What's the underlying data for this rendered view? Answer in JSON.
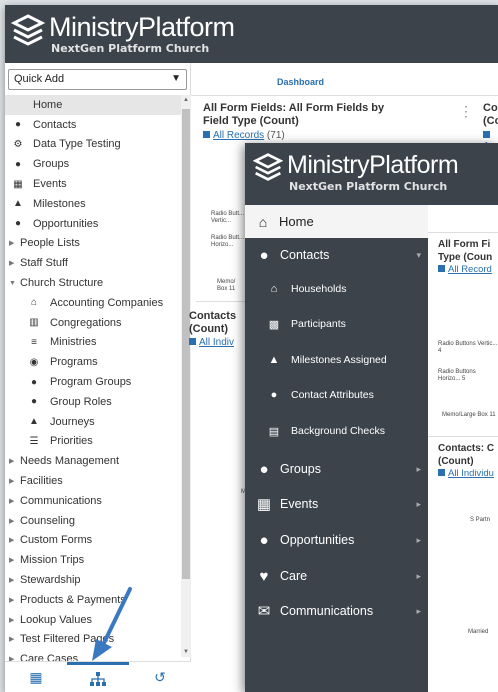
{
  "back": {
    "brand": "MinistryPlatform",
    "subtitle": "NextGen Platform Church",
    "quick_add": "Quick Add",
    "dashboard_tab": "Dashboard",
    "nav": [
      {
        "label": "Home",
        "type": "home"
      },
      {
        "label": "Contacts",
        "type": "top",
        "icon": "person-icon"
      },
      {
        "label": "Data Type Testing",
        "type": "top",
        "icon": "gear-icon"
      },
      {
        "label": "Groups",
        "type": "top",
        "icon": "people-icon"
      },
      {
        "label": "Events",
        "type": "top",
        "icon": "calendar-icon"
      },
      {
        "label": "Milestones",
        "type": "top",
        "icon": "graduation-cap-icon"
      },
      {
        "label": "Opportunities",
        "type": "top",
        "icon": "lightbulb-icon"
      },
      {
        "label": "People Lists",
        "type": "group"
      },
      {
        "label": "Staff Stuff",
        "type": "group"
      },
      {
        "label": "Church Structure",
        "type": "group-open"
      },
      {
        "label": "Accounting Companies",
        "type": "sub",
        "icon": "bank-icon"
      },
      {
        "label": "Congregations",
        "type": "sub",
        "icon": "building-icon"
      },
      {
        "label": "Ministries",
        "type": "sub",
        "icon": "signpost-icon"
      },
      {
        "label": "Programs",
        "type": "sub",
        "icon": "compass-icon"
      },
      {
        "label": "Program Groups",
        "type": "sub",
        "icon": "people-icon"
      },
      {
        "label": "Group Roles",
        "type": "sub",
        "icon": "people-icon"
      },
      {
        "label": "Journeys",
        "type": "sub",
        "icon": "graduation-cap-icon"
      },
      {
        "label": "Priorities",
        "type": "sub",
        "icon": "list-icon"
      },
      {
        "label": "Needs Management",
        "type": "group"
      },
      {
        "label": "Facilities",
        "type": "group"
      },
      {
        "label": "Communications",
        "type": "group"
      },
      {
        "label": "Counseling",
        "type": "group"
      },
      {
        "label": "Custom Forms",
        "type": "group"
      },
      {
        "label": "Mission Trips",
        "type": "group"
      },
      {
        "label": "Stewardship",
        "type": "group"
      },
      {
        "label": "Products & Payments",
        "type": "group"
      },
      {
        "label": "Lookup Values",
        "type": "group"
      },
      {
        "label": "Test Filtered Pages",
        "type": "group"
      },
      {
        "label": "Care Cases",
        "type": "group"
      }
    ],
    "card1": {
      "title": "All Form Fields: All Form Fields by Field Type (Count)",
      "link": "All Records",
      "count": "(71)",
      "labels": [
        "Radio Butt... Vertic...",
        "Radio Butt... Horizo...",
        "Memo/ Box 11"
      ]
    },
    "card2": {
      "title": "Contacts (Count)",
      "link": "All Indiv",
      "labels": [
        "Ma"
      ]
    },
    "card3": {
      "title": "Co (Co",
      "link": "A"
    }
  },
  "front": {
    "brand": "MinistryPlatform",
    "subtitle": "NextGen Platform Church",
    "home": "Home",
    "contacts": "Contacts",
    "sub_items": [
      "Households",
      "Participants",
      "Milestones Assigned",
      "Contact Attributes",
      "Background Checks"
    ],
    "main_items": [
      "Groups",
      "Events",
      "Opportunities",
      "Care",
      "Communications"
    ],
    "card1_title": "All Form Fi Type (Coun",
    "card1_link": "All Record",
    "card1_labels": [
      "Radio Buttons Vertic... 4",
      "Radio Buttons Horizo... 5",
      "Memo/Large Box 11"
    ],
    "card2_title": "Contacts: C (Count)",
    "card2_link": "All Individu",
    "card2_labels": [
      "S Partn",
      "Married"
    ]
  }
}
